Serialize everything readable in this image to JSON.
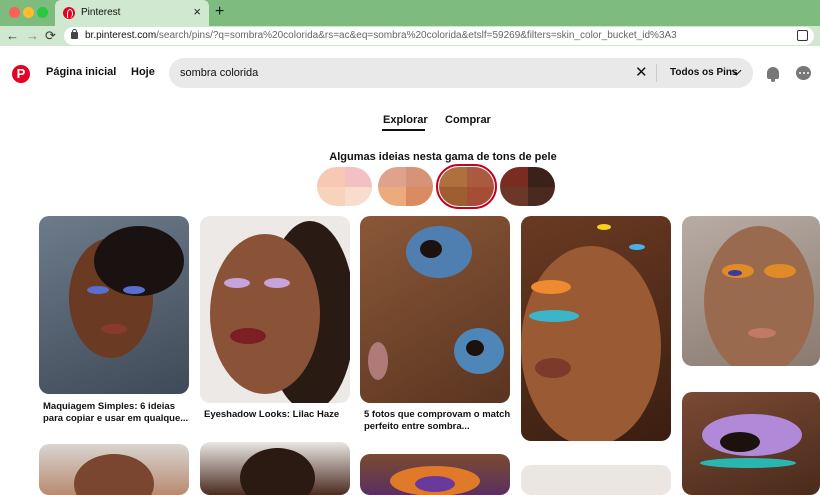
{
  "browser": {
    "tab_title": "Pinterest",
    "tab_close": "×",
    "new_tab": "+",
    "back": "←",
    "forward": "→",
    "reload": "⟳",
    "url_host": "br.pinterest.com",
    "url_path": "/search/pins/?q=sombra%20colorida&rs=ac&eq=sombra%20colorida&etslf=59269&filters=skin_color_bucket_id%3A3"
  },
  "header": {
    "logo_letter": "P",
    "home": "Página inicial",
    "today": "Hoje",
    "search_value": "sombra colorida",
    "clear": "✕",
    "filter": "Todos os Pins"
  },
  "tabs": {
    "explore": "Explorar",
    "shop": "Comprar"
  },
  "skin_heading": "Algumas ideias nesta gama de tons de pele",
  "skin_tones": [
    {
      "colors": [
        "#f7c9b4",
        "#f3c1c3",
        "#f6d3b9",
        "#f8dccc"
      ],
      "selected": false
    },
    {
      "colors": [
        "#e0a28a",
        "#d69377",
        "#ecab7c",
        "#d98c60"
      ],
      "selected": false
    },
    {
      "colors": [
        "#b0703e",
        "#ab5a40",
        "#9d5f30",
        "#a64d35"
      ],
      "selected": true
    },
    {
      "colors": [
        "#7b2c21",
        "#3a211a",
        "#6b3828",
        "#4a2a20"
      ],
      "selected": false
    }
  ],
  "pins": [
    {
      "caption": "Maquiagem Simples: 6 ideias para copiar e usar em qualque..."
    },
    {
      "caption": "Eyeshadow Looks: Lilac Haze"
    },
    {
      "caption": "5 fotos que comprovam o match perfeito entre sombra..."
    }
  ],
  "colors": {
    "brand": "#e60023",
    "chrome": "#7dbb7f"
  }
}
